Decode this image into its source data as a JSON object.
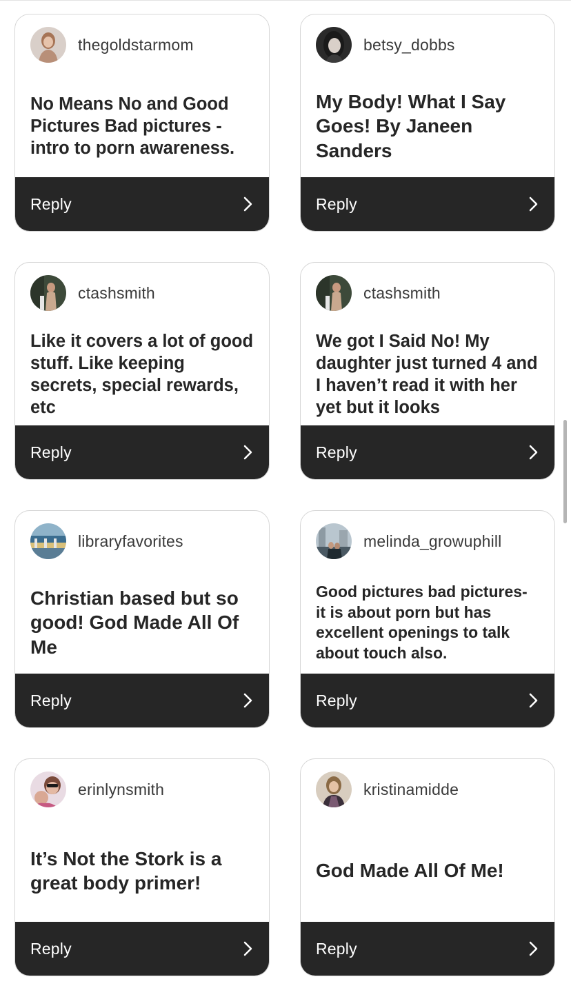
{
  "comments": [
    {
      "username": "thegoldstarmom",
      "text": "No Means No and Good Pictures Bad pictures - intro to porn awareness.",
      "reply_label": "Reply"
    },
    {
      "username": "betsy_dobbs",
      "text": "My Body! What I Say Goes! By Janeen Sanders",
      "reply_label": "Reply"
    },
    {
      "username": "ctashsmith",
      "text": "Like it covers a lot of good stuff. Like keeping secrets, special rewards, etc",
      "reply_label": "Reply"
    },
    {
      "username": "ctashsmith",
      "text": "We got I Said No! My daughter just turned 4 and I haven’t read it with her yet but it looks",
      "reply_label": "Reply"
    },
    {
      "username": "libraryfavorites",
      "text": "Christian based but so good! God Made All Of Me",
      "reply_label": "Reply"
    },
    {
      "username": "melinda_growuphill",
      "text": "Good pictures bad pictures- it is about porn but has excellent openings to talk about touch also.",
      "reply_label": "Reply"
    },
    {
      "username": "erinlynsmith",
      "text": "It’s Not the Stork is a great body primer!",
      "reply_label": "Reply"
    },
    {
      "username": "kristinamidde",
      "text": "God Made All Of Me!",
      "reply_label": "Reply"
    }
  ],
  "icons": {
    "reply_arrow": "chevron-right-icon"
  },
  "colors": {
    "reply_bar": "#262626",
    "card_border": "#d6d6d6",
    "text": "#262626"
  }
}
